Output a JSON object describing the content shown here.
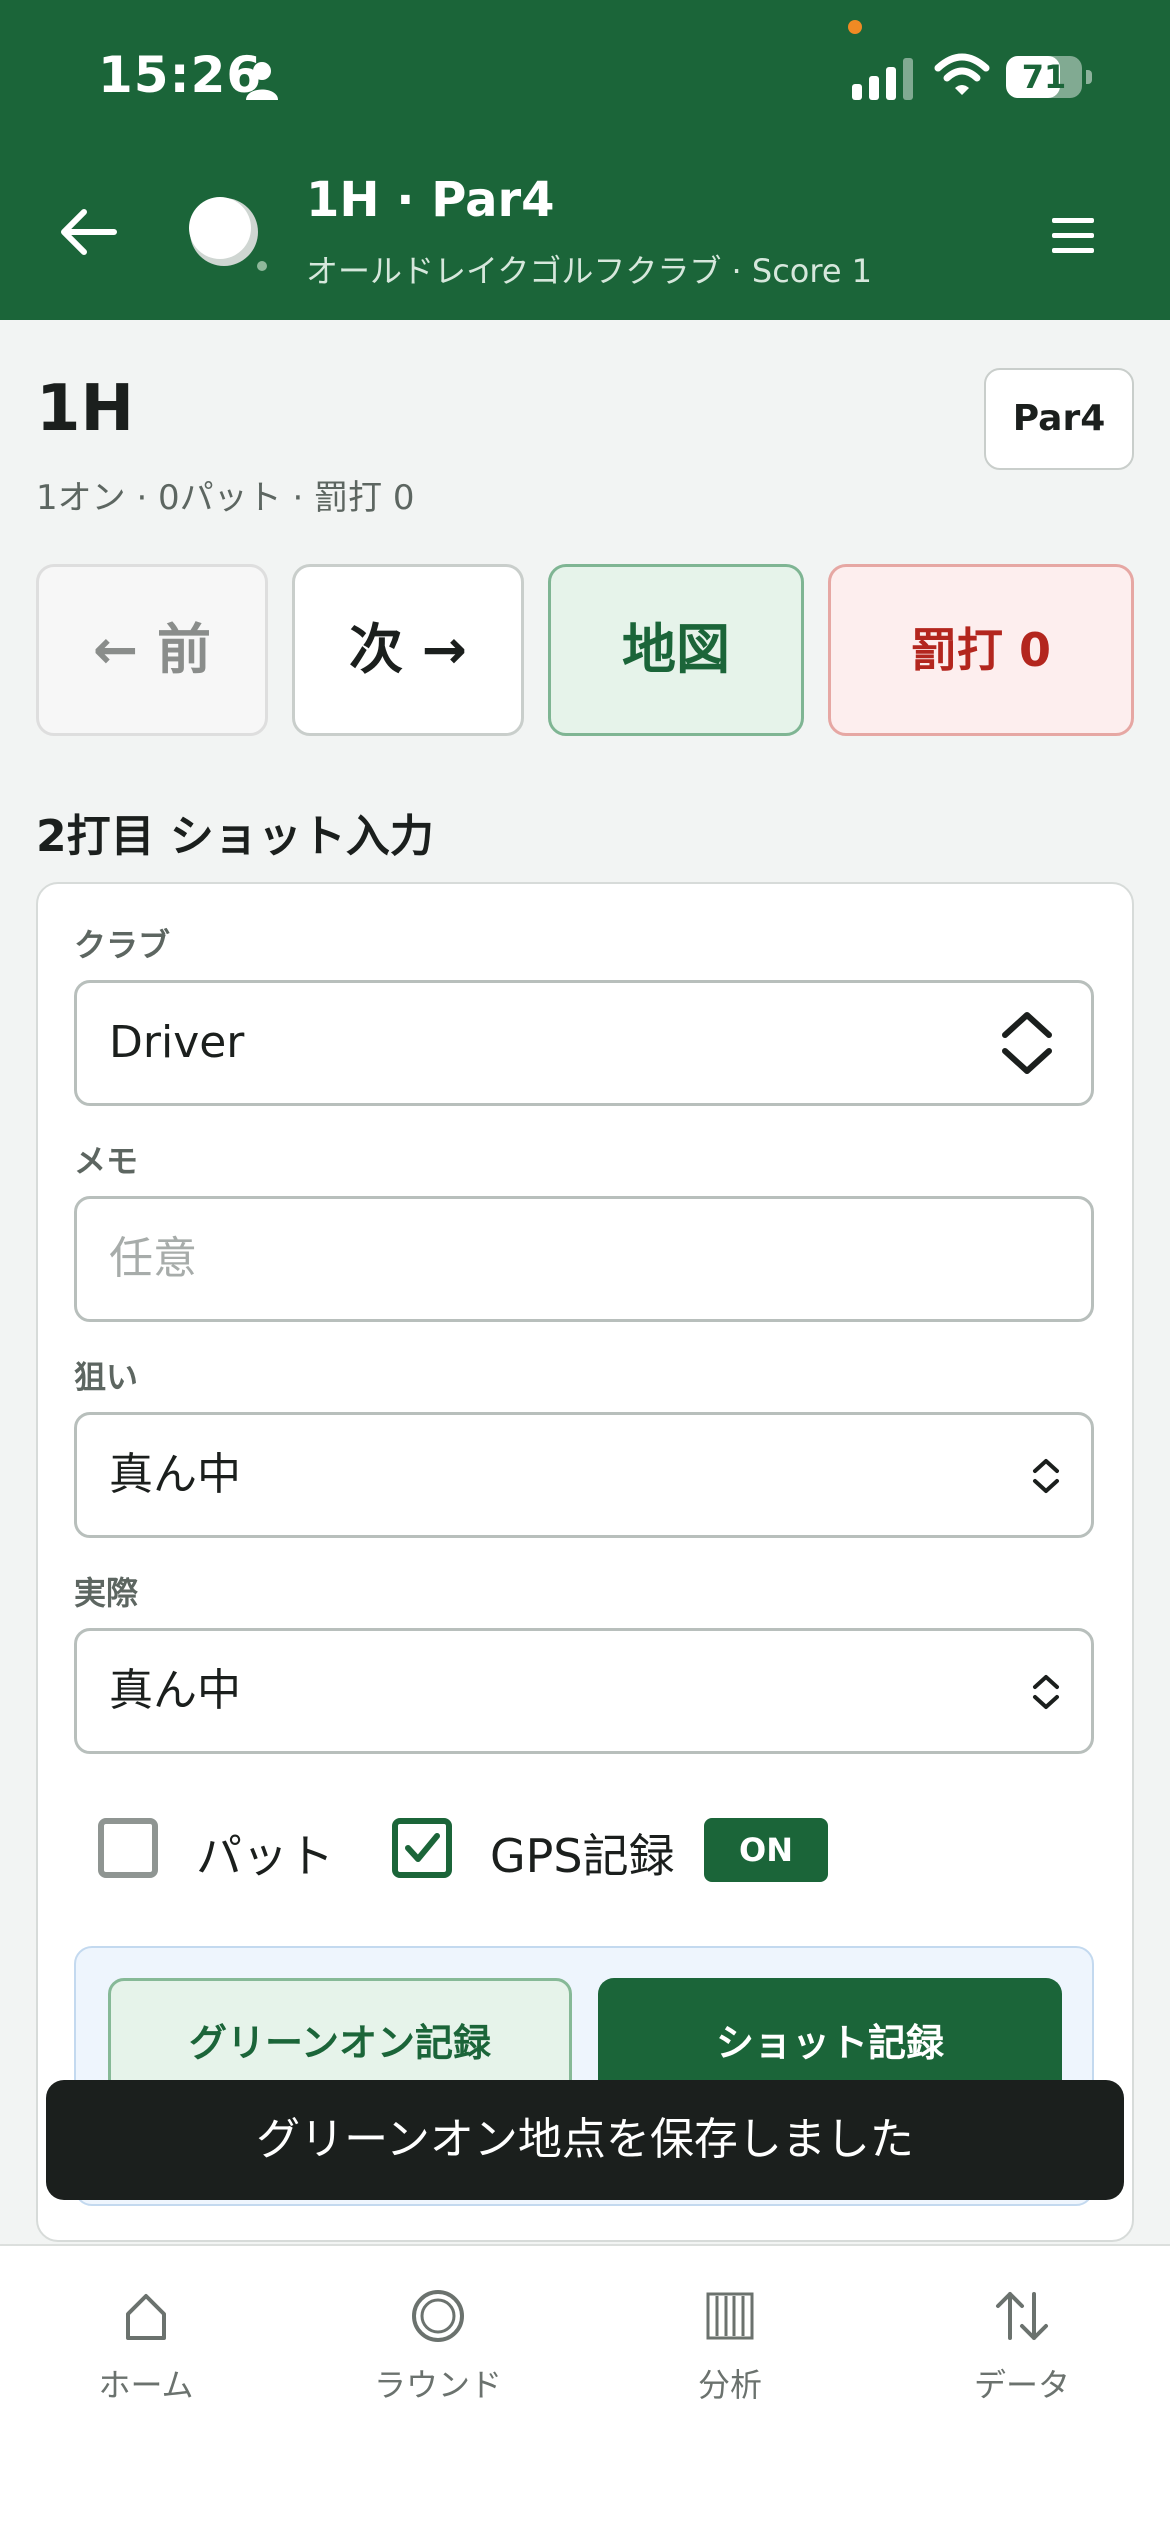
{
  "status_bar": {
    "time": "15:26",
    "battery": "71",
    "battery_level": 0.71
  },
  "header": {
    "title": "1H · Par4",
    "subtitle": "オールドレイクゴルフクラブ · Score 1",
    "brand_color": "#1b6539"
  },
  "hole": {
    "title": "1H",
    "summary": "1オン · 0パット · 罰打 0",
    "par_badge": "Par4"
  },
  "nav_buttons": {
    "prev": "← 前",
    "next": "次 →",
    "map": "地図",
    "penalty": "罰打 0"
  },
  "shot_form": {
    "section_title": "2打目 ショット入力",
    "club_label": "クラブ",
    "club_value": "Driver",
    "memo_label": "メモ",
    "memo_placeholder": "任意",
    "aim_label": "狙い",
    "aim_value": "真ん中",
    "actual_label": "実際",
    "actual_value": "真ん中",
    "putt_label": "パット",
    "putt_checked": false,
    "gps_label": "GPS記録",
    "gps_checked": true,
    "gps_badge": "ON",
    "green_on_button": "グリーンオン記録",
    "shot_button": "ショット記録"
  },
  "toast": {
    "message": "グリーンオン地点を保存しました"
  },
  "tab_bar": {
    "items": [
      {
        "label": "ホーム",
        "icon": "home-icon"
      },
      {
        "label": "ラウンド",
        "icon": "round-icon"
      },
      {
        "label": "分析",
        "icon": "analysis-icon"
      },
      {
        "label": "データ",
        "icon": "data-sort-icon"
      }
    ]
  }
}
